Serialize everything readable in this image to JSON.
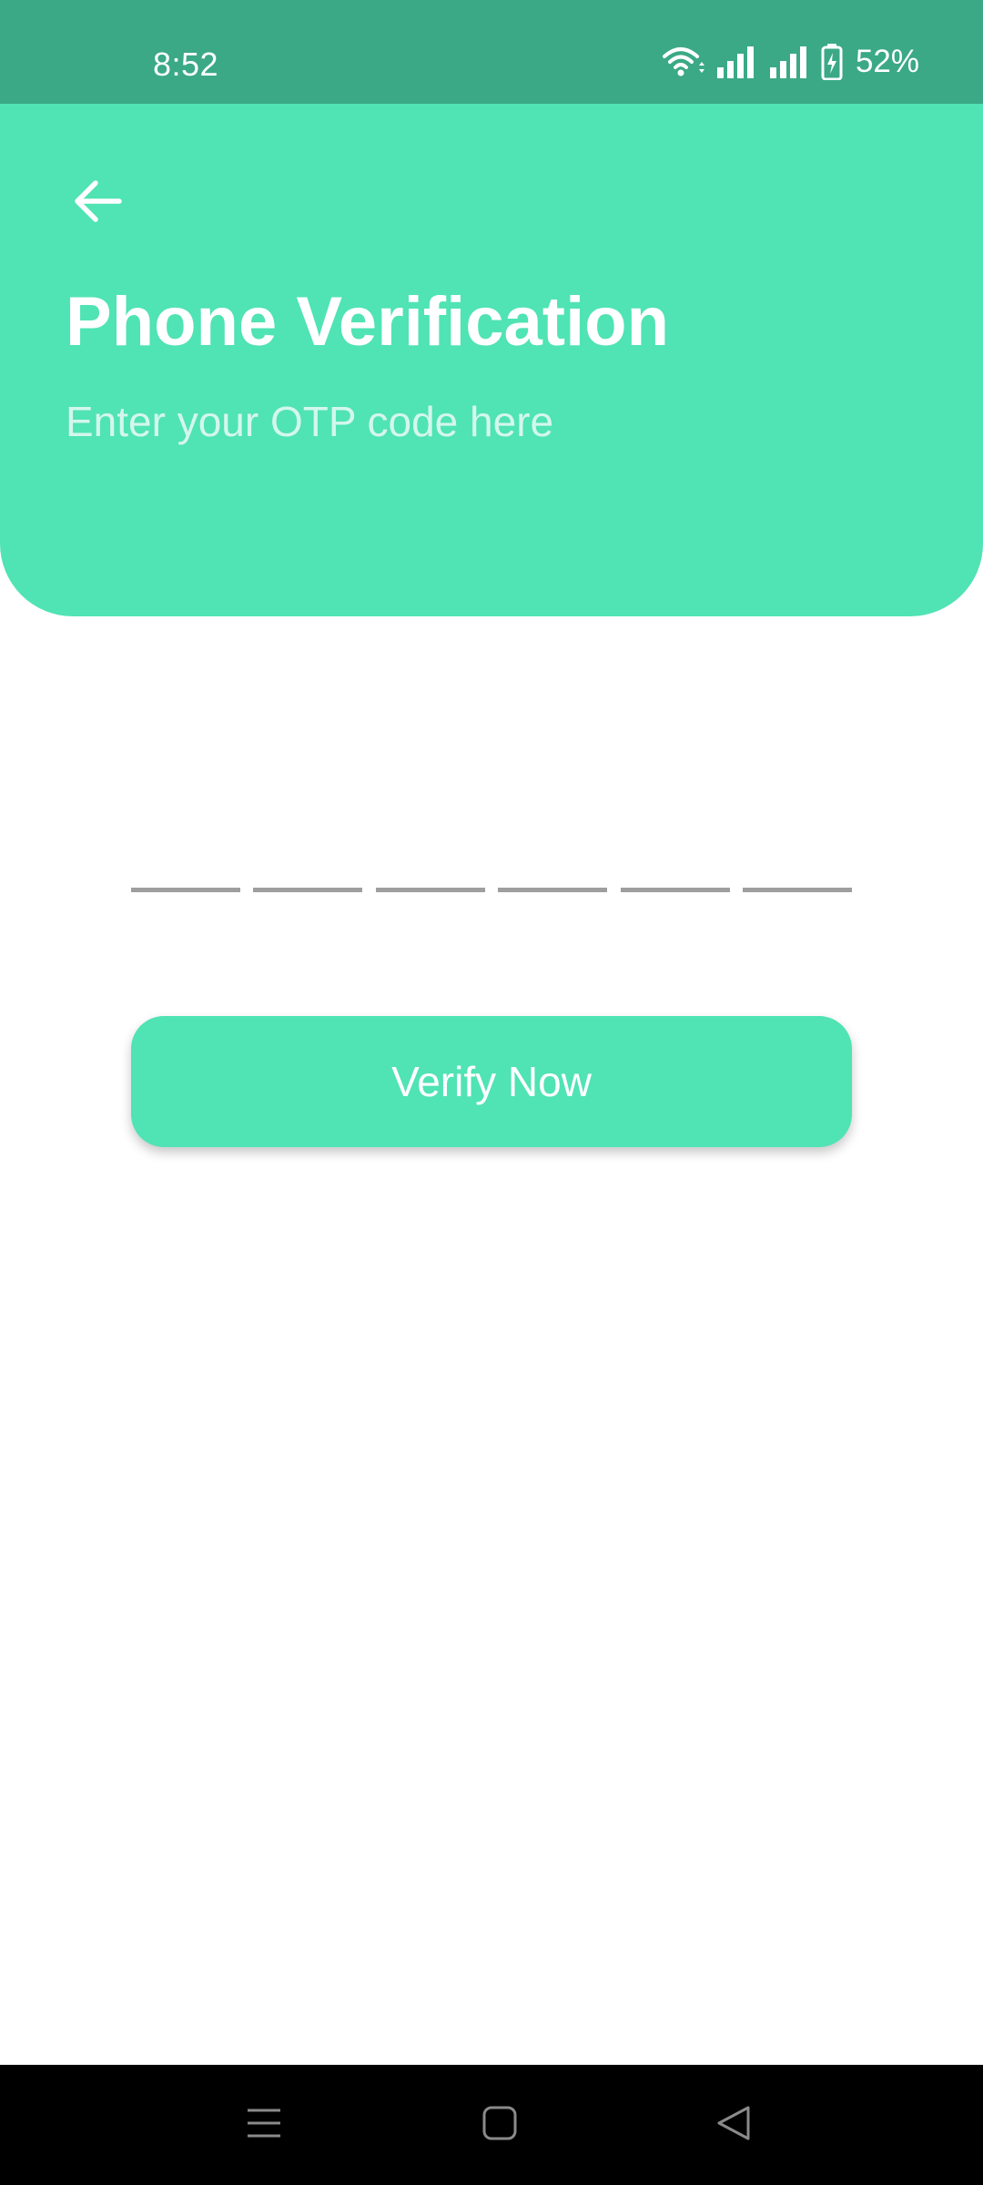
{
  "status_bar": {
    "time": "8:52",
    "battery": "52%",
    "icons": [
      "wifi-icon",
      "signal-icon",
      "signal-icon",
      "battery-charging-icon"
    ]
  },
  "header": {
    "back_icon": "arrow-left-icon",
    "title": "Phone Verification",
    "subtitle": "Enter your OTP code here"
  },
  "otp": {
    "digits": [
      "",
      "",
      "",
      "",
      "",
      ""
    ]
  },
  "actions": {
    "verify_label": "Verify Now"
  },
  "nav_bar": {
    "icons": [
      "menu-icon",
      "home-icon",
      "back-icon"
    ]
  },
  "colors": {
    "status_bar": "#3ba985",
    "accent": "#50e3b3",
    "subtitle": "#d4f7eb",
    "otp_underline": "#9e9e9e",
    "nav_bar": "#000000"
  }
}
